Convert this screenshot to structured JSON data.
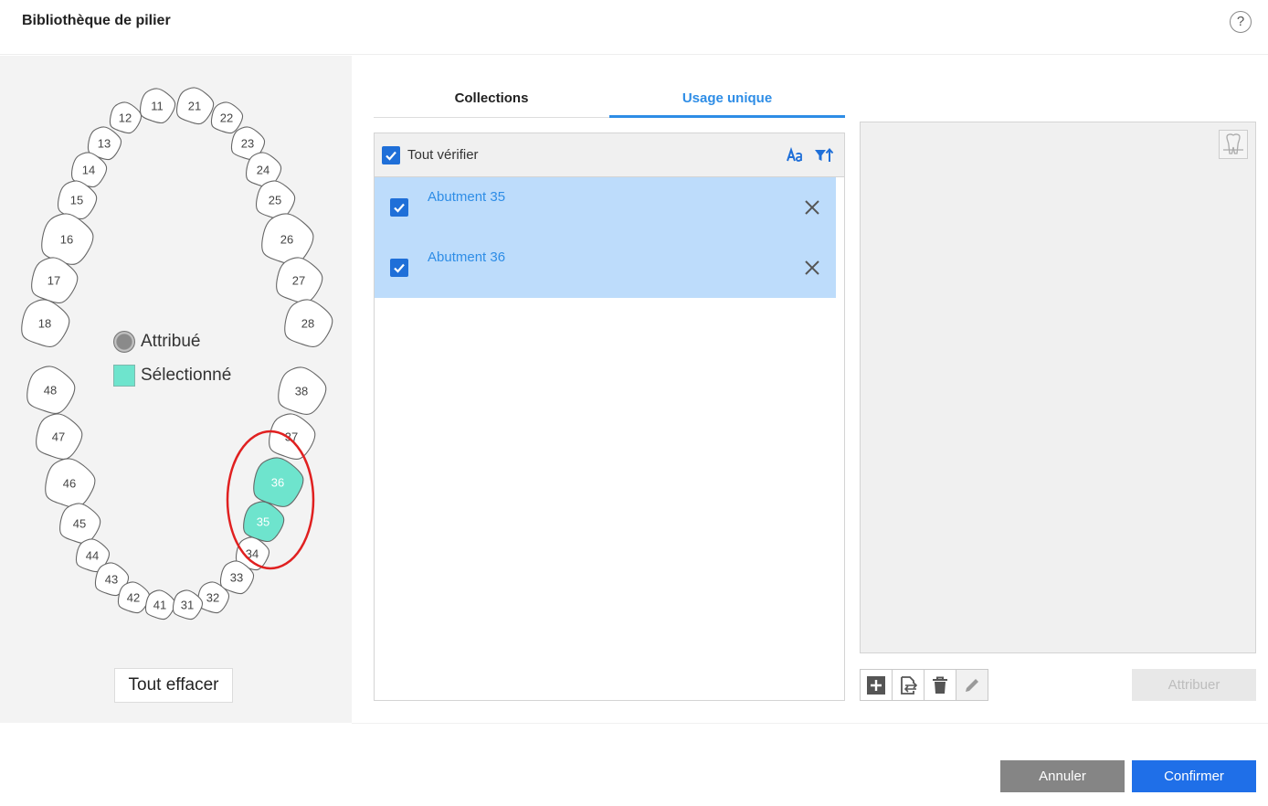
{
  "dialog": {
    "title": "Bibliothèque de pilier",
    "help_label": "?"
  },
  "legend": {
    "assigned": "Attribué",
    "selected": "Sélectionné"
  },
  "clear_label": "Tout effacer",
  "teeth": [
    {
      "num": "11",
      "state": "normal"
    },
    {
      "num": "21",
      "state": "normal"
    },
    {
      "num": "12",
      "state": "normal"
    },
    {
      "num": "22",
      "state": "normal"
    },
    {
      "num": "13",
      "state": "normal"
    },
    {
      "num": "23",
      "state": "normal"
    },
    {
      "num": "14",
      "state": "normal"
    },
    {
      "num": "24",
      "state": "normal"
    },
    {
      "num": "15",
      "state": "normal"
    },
    {
      "num": "25",
      "state": "normal"
    },
    {
      "num": "16",
      "state": "normal"
    },
    {
      "num": "26",
      "state": "normal"
    },
    {
      "num": "17",
      "state": "normal"
    },
    {
      "num": "27",
      "state": "normal"
    },
    {
      "num": "18",
      "state": "normal"
    },
    {
      "num": "28",
      "state": "normal"
    },
    {
      "num": "48",
      "state": "normal"
    },
    {
      "num": "38",
      "state": "normal"
    },
    {
      "num": "47",
      "state": "normal"
    },
    {
      "num": "37",
      "state": "normal"
    },
    {
      "num": "46",
      "state": "normal"
    },
    {
      "num": "36",
      "state": "selected"
    },
    {
      "num": "45",
      "state": "normal"
    },
    {
      "num": "35",
      "state": "selected"
    },
    {
      "num": "44",
      "state": "normal"
    },
    {
      "num": "34",
      "state": "normal"
    },
    {
      "num": "43",
      "state": "normal"
    },
    {
      "num": "33",
      "state": "normal"
    },
    {
      "num": "42",
      "state": "normal"
    },
    {
      "num": "32",
      "state": "normal"
    },
    {
      "num": "41",
      "state": "normal"
    },
    {
      "num": "31",
      "state": "normal"
    }
  ],
  "colors": {
    "selected": "#6ee4cd",
    "accent": "#2e8de6",
    "highlight_circle": "#e02020"
  },
  "tabs": [
    {
      "label": "Collections",
      "active": false
    },
    {
      "label": "Usage unique",
      "active": true
    }
  ],
  "list": {
    "check_all_label": "Tout vérifier",
    "items": [
      {
        "label": "Abutment 35",
        "checked": true
      },
      {
        "label": "Abutment 36",
        "checked": true
      }
    ]
  },
  "icons": {
    "sort_alpha": "sort-alpha-icon",
    "sort_filter": "filter-sort-icon",
    "preview": "tooth-preview-icon",
    "add": "add-icon",
    "import": "import-icon",
    "delete": "trash-icon",
    "edit": "pencil-icon",
    "remove": "close-icon"
  },
  "assign_label": "Attribuer",
  "footer": {
    "cancel_label": "Annuler",
    "confirm_label": "Confirmer"
  }
}
